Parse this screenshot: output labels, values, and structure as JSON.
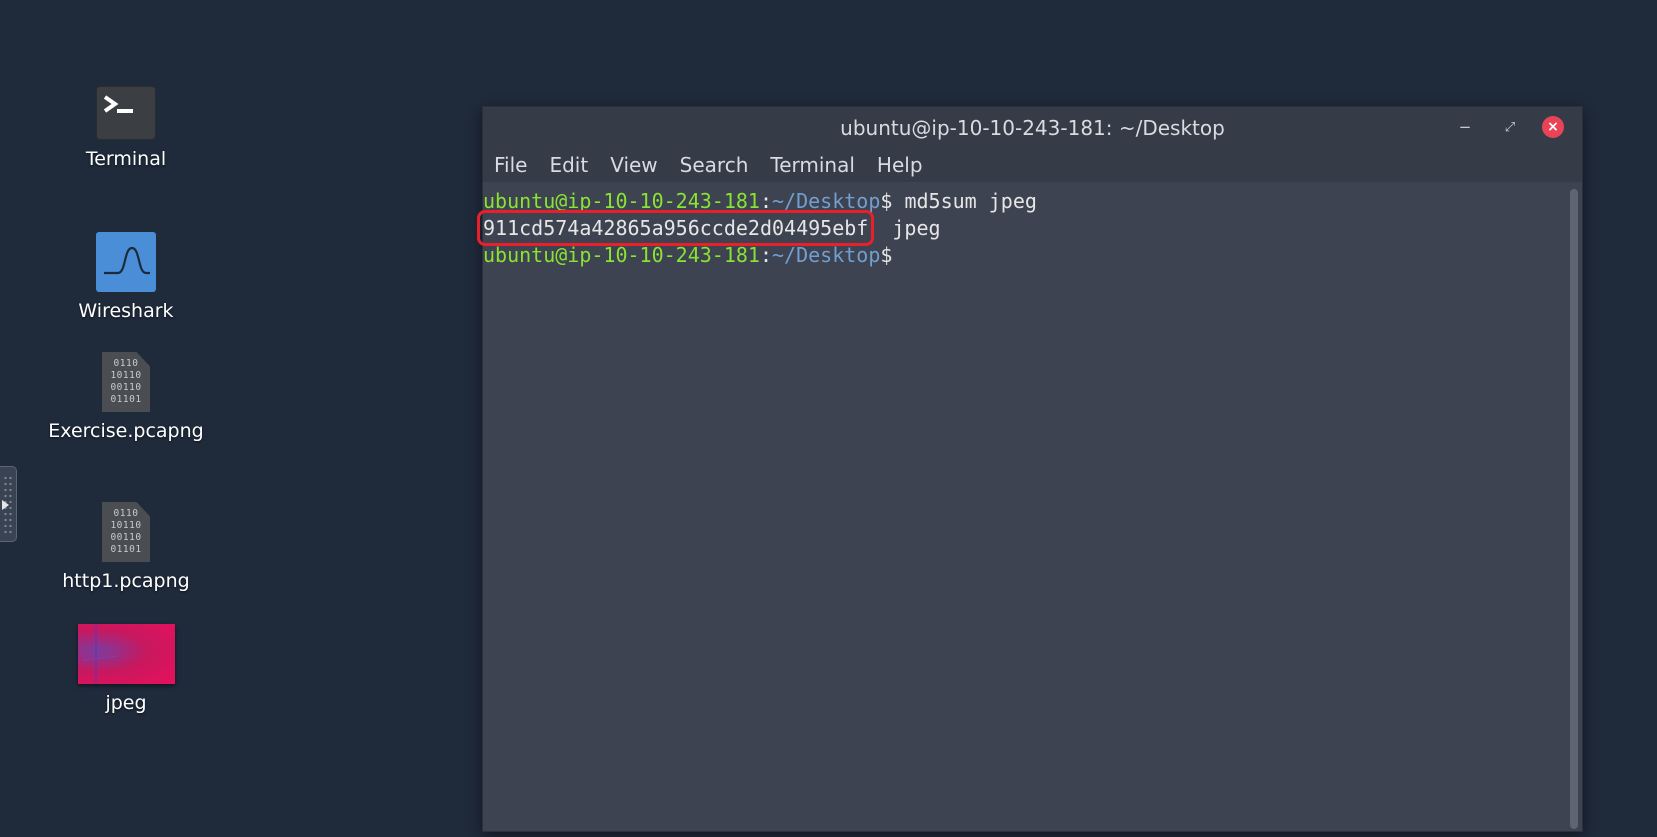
{
  "desktop": {
    "icons": [
      {
        "label": "Terminal",
        "icon": "terminal-icon"
      },
      {
        "label": "Wireshark",
        "icon": "wireshark-icon"
      },
      {
        "label": "Exercise.pcapng",
        "icon": "binary-file-icon"
      },
      {
        "label": "http1.pcapng",
        "icon": "binary-file-icon"
      },
      {
        "label": "jpeg",
        "icon": "image-thumbnail"
      }
    ],
    "background_color": "#1f2a3b"
  },
  "terminal_window": {
    "title": "ubuntu@ip-10-10-243-181: ~/Desktop",
    "menu": [
      "File",
      "Edit",
      "View",
      "Search",
      "Terminal",
      "Help"
    ],
    "lines": [
      {
        "user": "ubuntu@ip-10-10-243-181",
        "sep": ":",
        "path": "~/Desktop",
        "prompt": "$",
        "command": " md5sum jpeg"
      },
      {
        "hash": "911cd574a42865a956ccde2d04495ebf",
        "filename": "  jpeg"
      },
      {
        "user": "ubuntu@ip-10-10-243-181",
        "sep": ":",
        "path": "~/Desktop",
        "prompt": "$",
        "command": ""
      }
    ],
    "colors": {
      "user": "#8ae234",
      "path": "#729fcf",
      "highlight_box": "#e8202a",
      "close_button": "#e84357"
    }
  }
}
